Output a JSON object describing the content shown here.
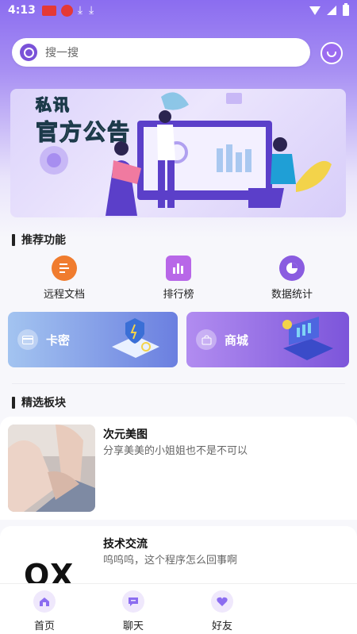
{
  "status_bar": {
    "time": "4:13"
  },
  "search": {
    "placeholder": "搜一搜"
  },
  "banner": {
    "title_line1": "私讯",
    "title_line2": "官方公告"
  },
  "recommend": {
    "title": "推荐功能",
    "items": [
      {
        "label": "远程文档",
        "icon": "document-icon",
        "color": "#f07c2e"
      },
      {
        "label": "排行榜",
        "icon": "bar-chart-icon",
        "color": "#b867e8"
      },
      {
        "label": "数据统计",
        "icon": "pie-chart-icon",
        "color": "#8a5ce0"
      }
    ]
  },
  "promos": [
    {
      "label": "卡密",
      "icon": "card-icon",
      "gradient": [
        "#a3c4f0",
        "#6b7fe0"
      ]
    },
    {
      "label": "商城",
      "icon": "shopping-bag-icon",
      "gradient": [
        "#b18cf0",
        "#7c55da"
      ]
    }
  ],
  "featured": {
    "title": "精选板块",
    "cards": [
      {
        "title": "次元美图",
        "desc": "分享美美的小姐姐也不是不可以"
      },
      {
        "title": "技术交流",
        "desc": "呜呜呜，这个程序怎么回事啊",
        "logo_text": "OX"
      }
    ]
  },
  "bottom_nav": [
    {
      "label": "首页",
      "icon": "home-icon"
    },
    {
      "label": "聊天",
      "icon": "chat-icon"
    },
    {
      "label": "好友",
      "icon": "heart-icon"
    }
  ],
  "colors": {
    "accent": "#8b6df0",
    "brand_purple": "#7a52d8"
  }
}
